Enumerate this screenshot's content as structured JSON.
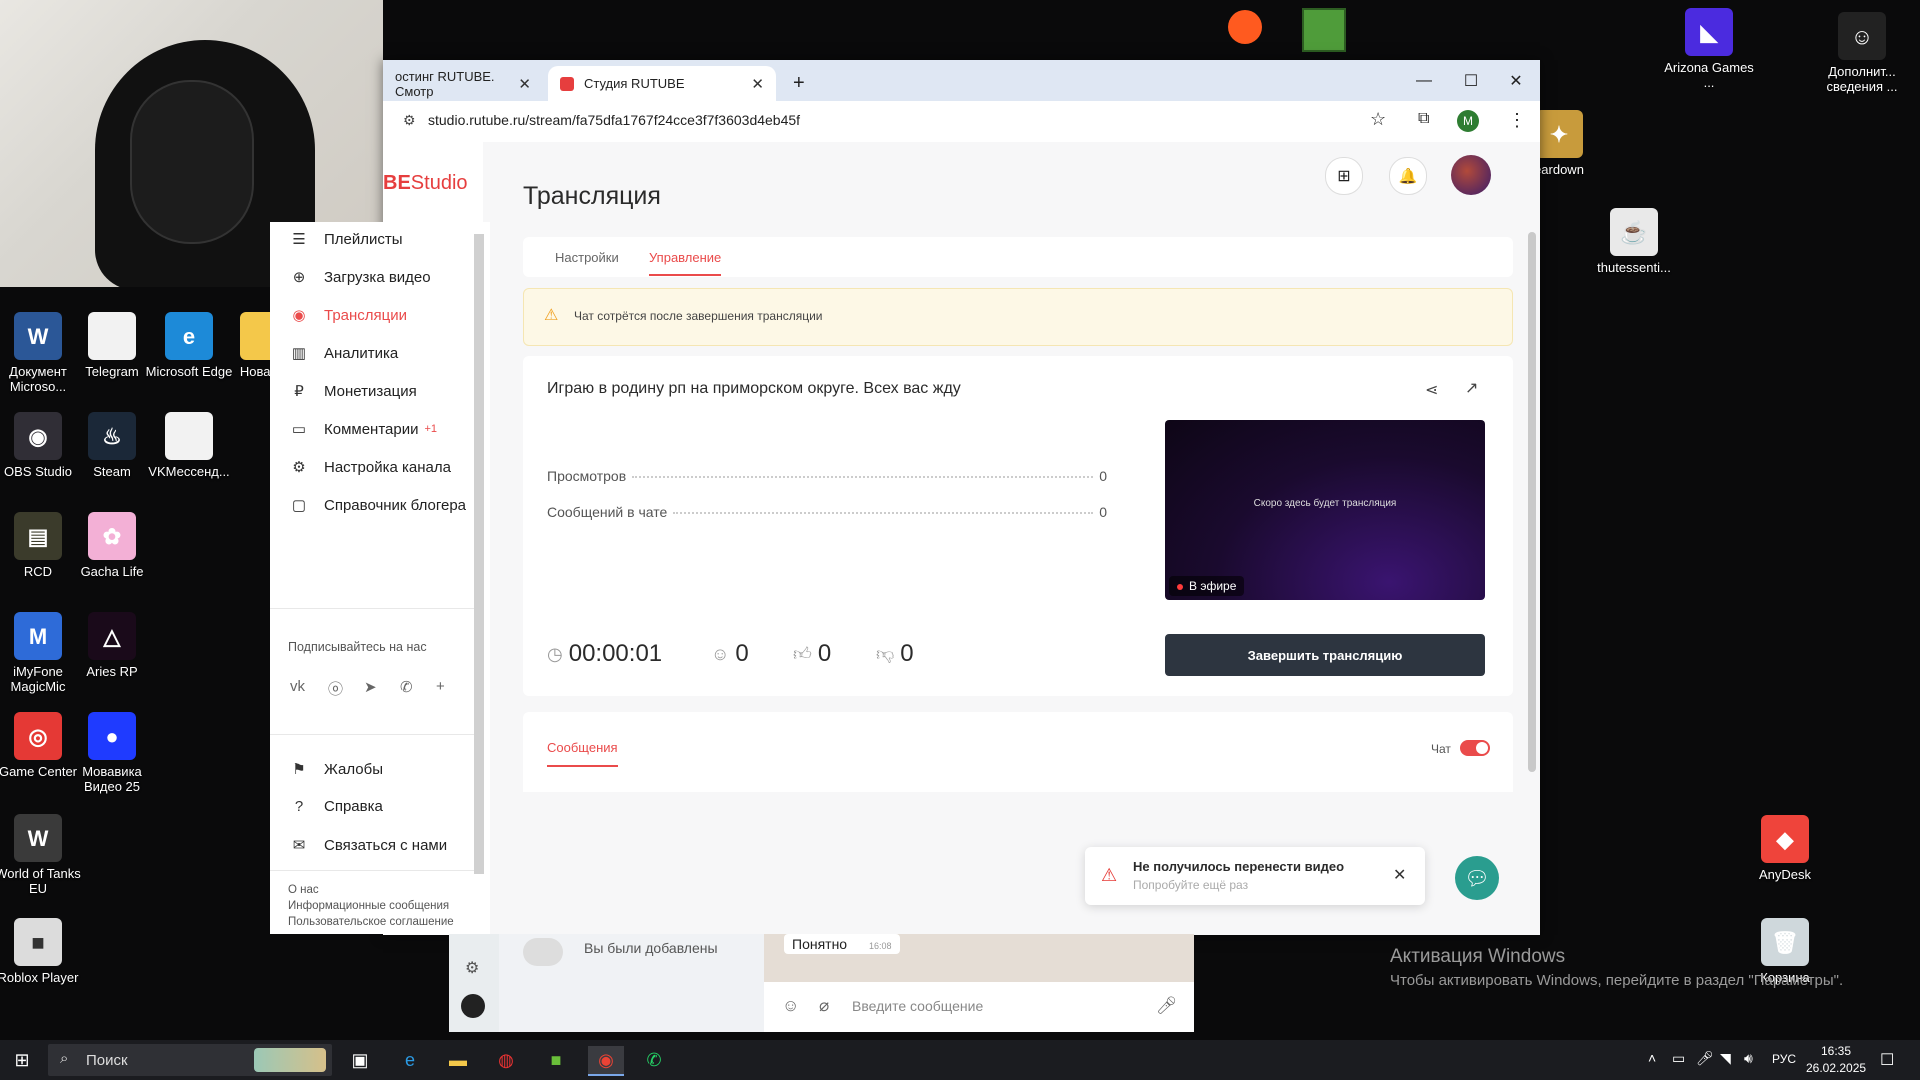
{
  "desktop": {
    "icons_left": [
      {
        "label": "Документ Microso...",
        "glyph": "W",
        "color": "#2b5797"
      },
      {
        "label": "Telegram",
        "glyph": "",
        "color": "#f2f2f2"
      },
      {
        "label": "Microsoft Edge",
        "glyph": "e",
        "color": "#1d8ad8"
      },
      {
        "label": "Новая п",
        "glyph": "",
        "color": "#f4c84a"
      },
      {
        "label": "OBS Studio",
        "glyph": "◉",
        "color": "#302e36"
      },
      {
        "label": "Steam",
        "glyph": "♨",
        "color": "#1b2838"
      },
      {
        "label": "VKМессенд...",
        "glyph": "",
        "color": "#f2f2f2"
      },
      {
        "label": "RCD",
        "glyph": "▤",
        "color": "#3b3b2b"
      },
      {
        "label": "Gacha Life",
        "glyph": "✿",
        "color": "#f3b0d6"
      },
      {
        "label": "iMyFone MagicMic",
        "glyph": "M",
        "color": "#2e6bd8"
      },
      {
        "label": "Aries RP",
        "glyph": "△",
        "color": "#1a0a1a"
      },
      {
        "label": "Game Center",
        "glyph": "◎",
        "color": "#e53935"
      },
      {
        "label": "Мовавика Видео 25",
        "glyph": "●",
        "color": "#1f3bff"
      },
      {
        "label": "World of Tanks EU",
        "glyph": "W",
        "color": "#3a3a3a"
      },
      {
        "label": "Roblox Player",
        "glyph": "■",
        "color": "#dcdcdc"
      }
    ],
    "icons_right": [
      {
        "label": "Arizona Games ...",
        "glyph": "◣",
        "color": "#4b2bdf"
      },
      {
        "label": "Дополнит... сведения ...",
        "glyph": "☺",
        "color": "#222"
      },
      {
        "label": "eardown",
        "glyph": "✦",
        "color": "#c89b3c"
      },
      {
        "label": "thutessenti...",
        "glyph": "☕",
        "color": "#e9e9e9"
      },
      {
        "label": "AnyDesk",
        "glyph": "◆",
        "color": "#ef443b"
      },
      {
        "label": "Корзина",
        "glyph": "🗑",
        "color": "#cfd8dc"
      }
    ],
    "activation_title": "Активация Windows",
    "activation_text": "Чтобы активировать Windows, перейдите в раздел \"Параметры\"."
  },
  "browser": {
    "tabs": [
      {
        "title": "остинг RUTUBE. Смотр",
        "active": false
      },
      {
        "title": "Студия RUTUBE",
        "active": true
      }
    ],
    "url": "studio.rutube.ru/stream/fa75dfa1767f24cce3f7f3603d4eb45f",
    "profile_initial": "M"
  },
  "studio": {
    "logo_left": "BE",
    "logo_right": "Studio",
    "page_title": "Трансляция",
    "tabs": [
      "Настройки",
      "Управление"
    ],
    "active_tab": "Управление",
    "warning": "Чат сотрётся после завершения трансляции",
    "stream_title": "Играю в родину рп на приморском округе. Всех вас жду",
    "stats": [
      {
        "label": "Просмотров",
        "value": "0"
      },
      {
        "label": "Сообщений в чате",
        "value": "0"
      }
    ],
    "preview_text": "Скоро здесь будет трансляция",
    "live_badge": "В эфире",
    "end_button": "Завершить трансляцию",
    "timer": "00:00:01",
    "viewers": "0",
    "likes": "0",
    "dislikes": "0",
    "messages_tab": "Сообщения",
    "chat_label": "Чат",
    "chat_enabled": true,
    "toast_title": "Не получилось перенести видео",
    "toast_subtitle": "Попробуйте ещё раз"
  },
  "sidebar": {
    "items": [
      {
        "label": "Плейлисты",
        "icon": "list-icon",
        "glyph": "☰"
      },
      {
        "label": "Загрузка видео",
        "icon": "upload-icon",
        "glyph": "⊕"
      },
      {
        "label": "Трансляции",
        "icon": "broadcast-icon",
        "glyph": "◉"
      },
      {
        "label": "Аналитика",
        "icon": "analytics-icon",
        "glyph": "▥"
      },
      {
        "label": "Монетизация",
        "icon": "ruble-icon",
        "glyph": "₽"
      },
      {
        "label": "Комментарии",
        "icon": "comment-icon",
        "glyph": "▭"
      },
      {
        "label": "Настройка канала",
        "icon": "gear-icon",
        "glyph": "⚙"
      },
      {
        "label": "Справочник блогера",
        "icon": "guide-icon",
        "glyph": "▢"
      }
    ],
    "comments_badge": "+1",
    "follow_label": "Подписывайтесь на нас",
    "social": [
      "vk",
      "ok",
      "telegram",
      "viber",
      "more"
    ],
    "bottom_items": [
      {
        "label": "Жалобы",
        "glyph": "⚑"
      },
      {
        "label": "Справка",
        "glyph": "?"
      },
      {
        "label": "Связаться с нами",
        "glyph": "✉"
      }
    ],
    "footer_links": [
      "О нас",
      "Информационные сообщения",
      "Пользовательское соглашение"
    ]
  },
  "whatsapp": {
    "added_text": "Вы были добавлены",
    "reply_bubble": "Понятно",
    "reply_time": "16:08",
    "input_placeholder": "Введите сообщение"
  },
  "taskbar": {
    "search_placeholder": "Поиск",
    "language": "РУС",
    "time": "16:35",
    "date": "26.02.2025"
  }
}
